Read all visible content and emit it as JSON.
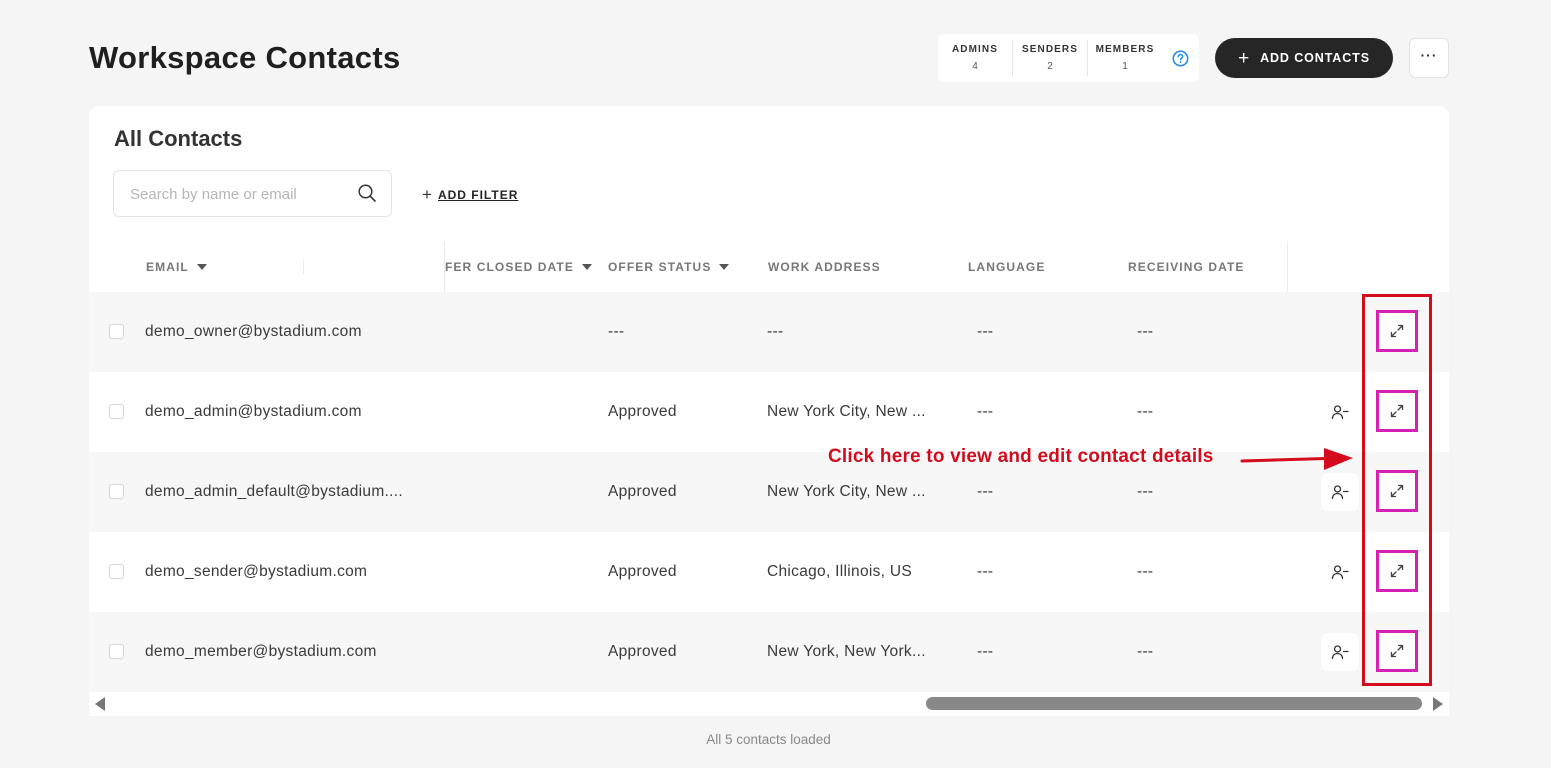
{
  "page": {
    "title": "Workspace Contacts"
  },
  "stats": [
    {
      "label": "ADMINS",
      "count": "4"
    },
    {
      "label": "SENDERS",
      "count": "2"
    },
    {
      "label": "MEMBERS",
      "count": "1"
    }
  ],
  "actions": {
    "add_contacts_label": "ADD CONTACTS",
    "more_label": "···"
  },
  "card": {
    "title": "All Contacts"
  },
  "search": {
    "placeholder": "Search by name or email",
    "value": ""
  },
  "filter": {
    "add_label": "ADD FILTER"
  },
  "table": {
    "columns": {
      "email": "EMAIL",
      "offer_closed_date": "FER CLOSED DATE",
      "offer_status": "OFFER STATUS",
      "work_address": "WORK ADDRESS",
      "language": "LANGUAGE",
      "receiving_date": "RECEIVING DATE"
    },
    "rows": [
      {
        "email": "demo_owner@bystadium.com",
        "offer_closed_date": "",
        "offer_status": "---",
        "work_address": "---",
        "language": "---",
        "receiving_date": "---"
      },
      {
        "email": "demo_admin@bystadium.com",
        "offer_closed_date": "",
        "offer_status": "Approved",
        "work_address": "New York City, New ...",
        "language": "---",
        "receiving_date": "---"
      },
      {
        "email": "demo_admin_default@bystadium....",
        "offer_closed_date": "",
        "offer_status": "Approved",
        "work_address": "New York City, New ...",
        "language": "---",
        "receiving_date": "---"
      },
      {
        "email": "demo_sender@bystadium.com",
        "offer_closed_date": "",
        "offer_status": "Approved",
        "work_address": "Chicago, Illinois, US",
        "language": "---",
        "receiving_date": "---"
      },
      {
        "email": "demo_member@bystadium.com",
        "offer_closed_date": "",
        "offer_status": "Approved",
        "work_address": "New York, New York...",
        "language": "---",
        "receiving_date": "---"
      }
    ]
  },
  "annotation": {
    "text": "Click here to view and edit contact details"
  },
  "footer": {
    "status": "All 5 contacts loaded"
  },
  "colors": {
    "accent": "#1e88e5",
    "annotation_red": "#d40b1c",
    "highlight_magenta": "#d61fb4",
    "primary_button": "#262626"
  },
  "icons": {
    "help": "help-circle-icon",
    "search": "search-icon",
    "remove_user": "user-minus-icon",
    "expand": "expand-arrows-icon"
  }
}
